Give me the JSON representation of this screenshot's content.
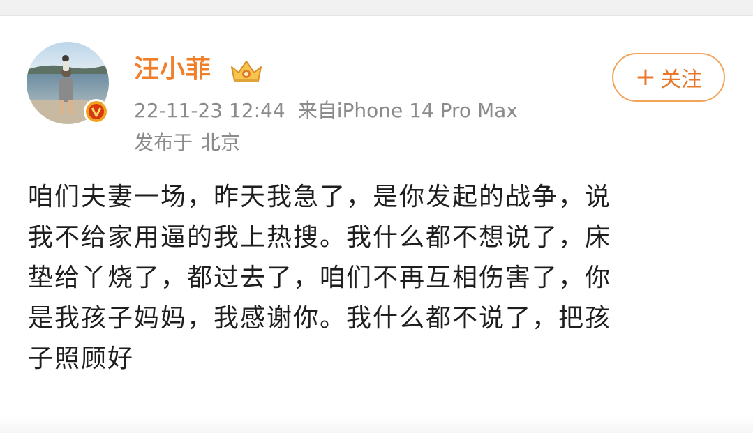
{
  "post": {
    "author": {
      "name": "汪小菲",
      "avatar_icon": "avatar-photo-icon",
      "verified_badge_icon": "verified-v-icon",
      "vip_icon": "crown-icon",
      "name_color": "#f17f2a"
    },
    "meta": {
      "timestamp": "22-11-23 12:44",
      "source": "来自iPhone 14 Pro Max",
      "location_prefix": "发布于",
      "location": "北京"
    },
    "follow_button": {
      "plus": "+",
      "label": "关注",
      "color": "#e8772a"
    },
    "content_lines": [
      "咱们夫妻一场，昨天我急了，是你发起的战争，说",
      "我不给家用逼的我上热搜。我什么都不想说了，床",
      "垫给丫烧了，都过去了，咱们不再互相伤害了，你",
      "是我孩子妈妈，我感谢你。我什么都不说了，把孩",
      "子照顾好"
    ]
  }
}
